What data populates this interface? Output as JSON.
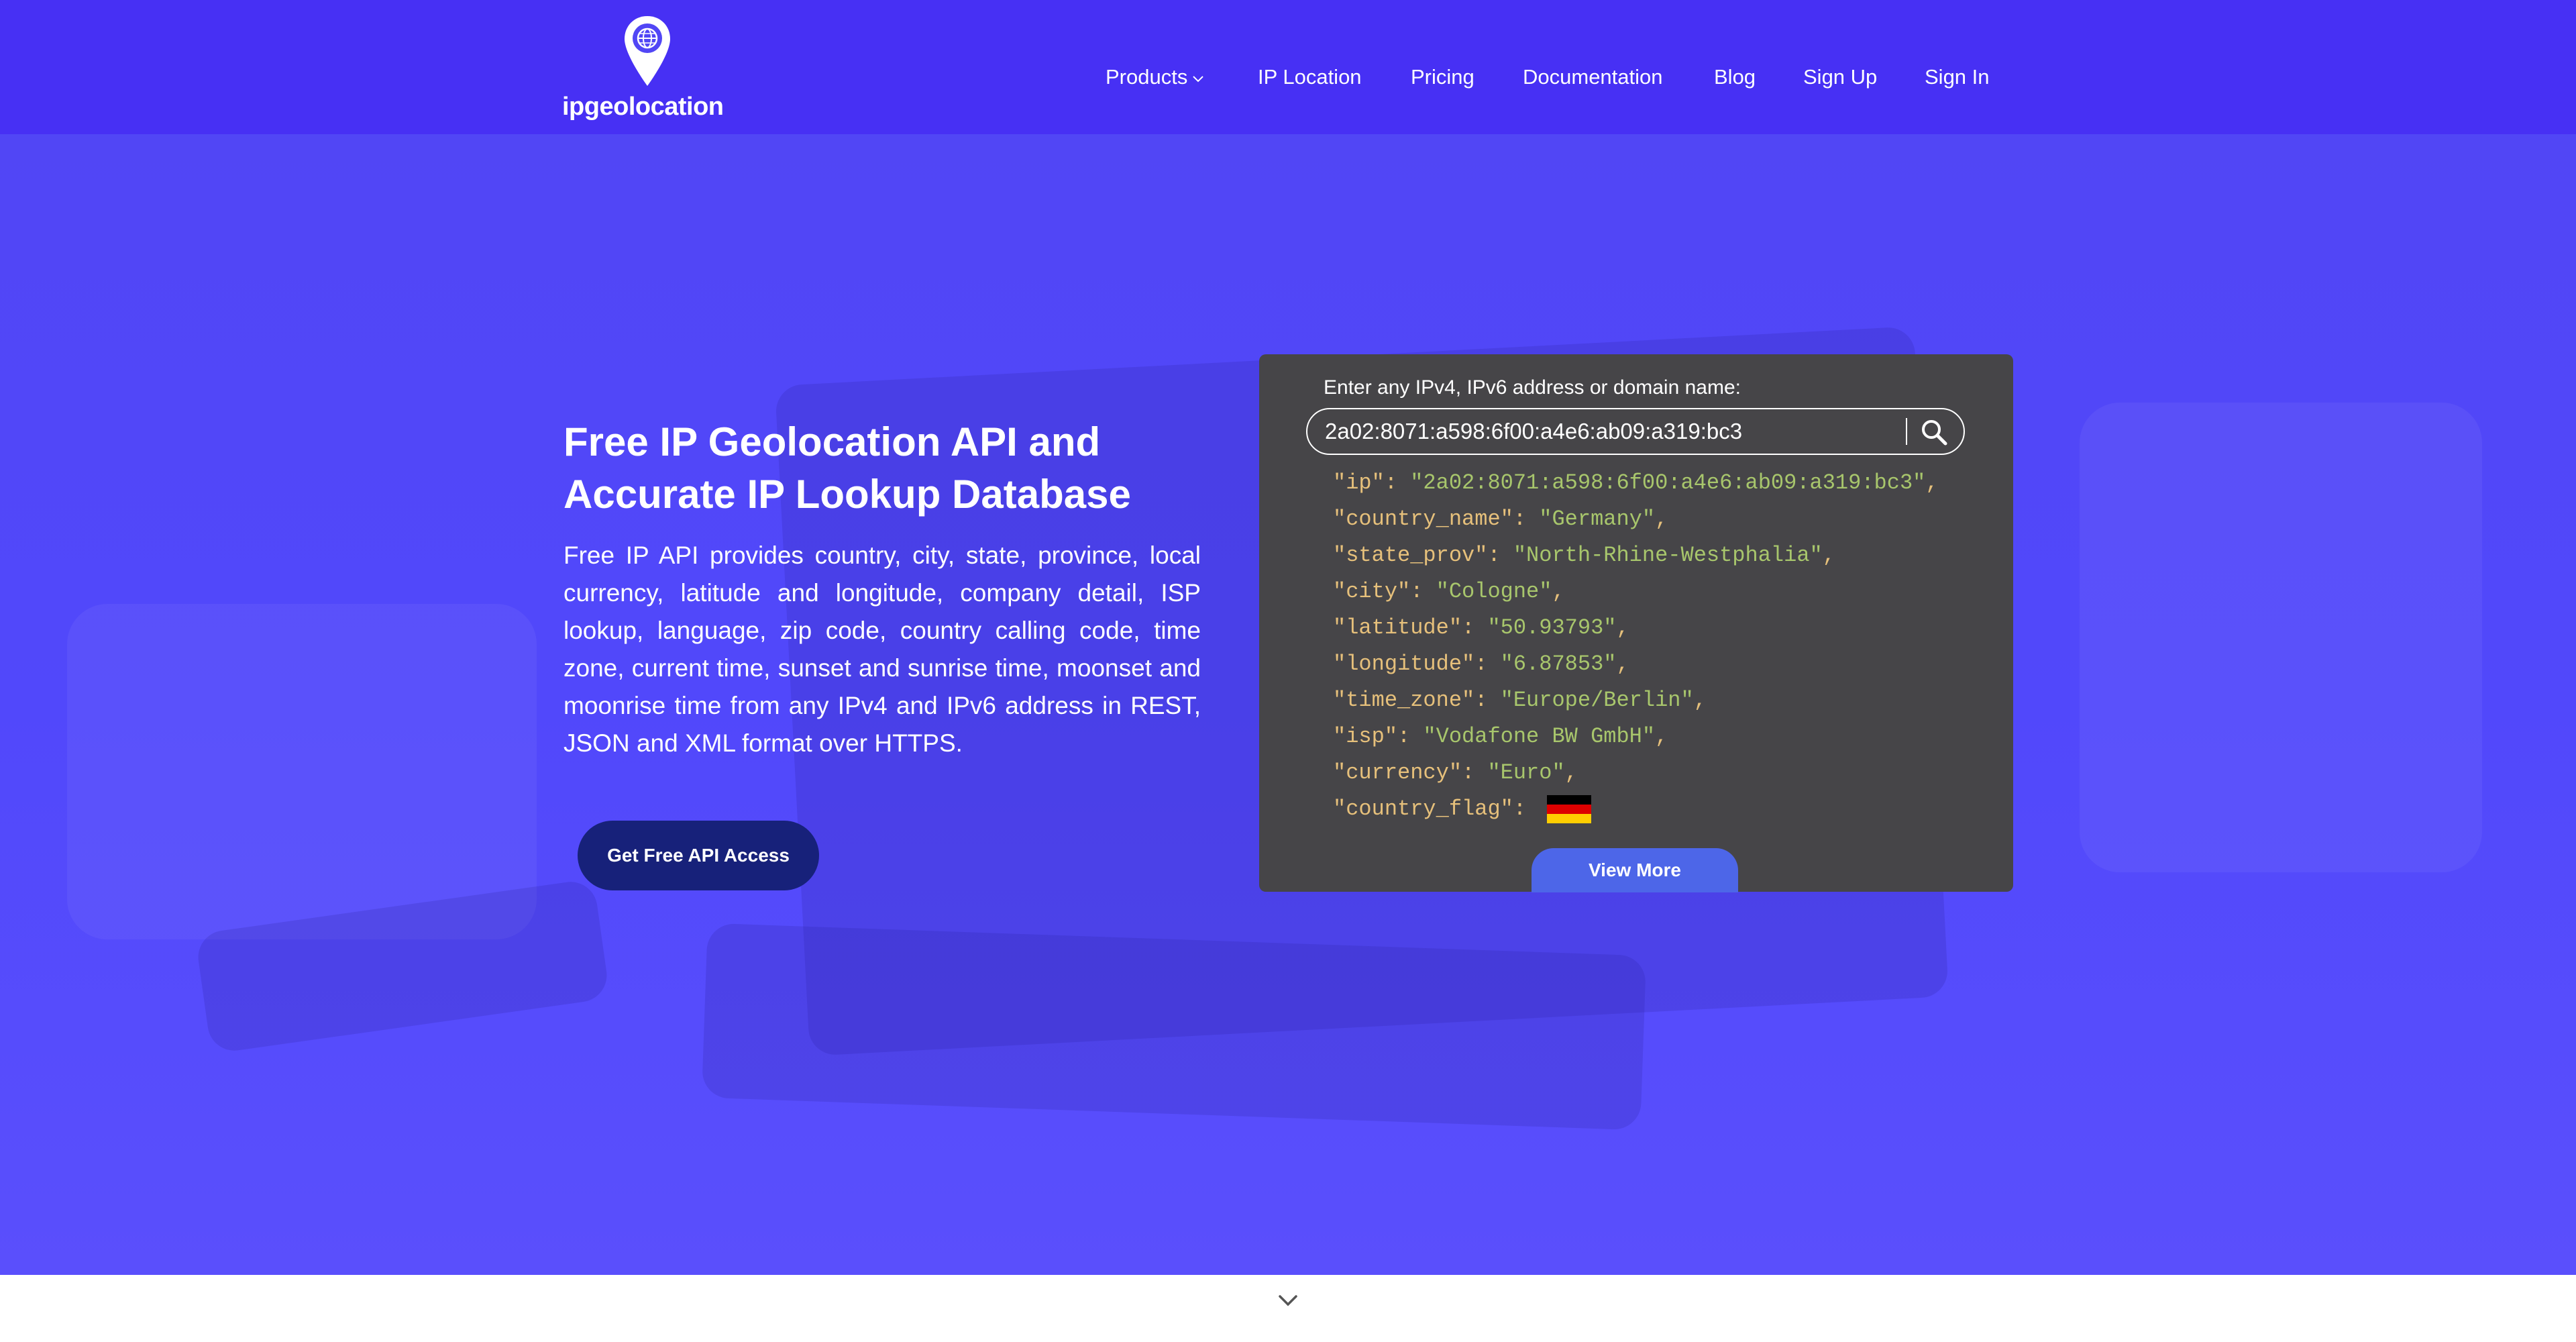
{
  "brand": {
    "name": "ipgeolocation"
  },
  "nav": {
    "items": [
      {
        "label": "Products",
        "has_dropdown": true
      },
      {
        "label": "IP Location"
      },
      {
        "label": "Pricing"
      },
      {
        "label": "Documentation"
      },
      {
        "label": "Blog"
      },
      {
        "label": "Sign Up"
      },
      {
        "label": "Sign In"
      }
    ],
    "dropdown_icon": "chevron-down-icon"
  },
  "hero": {
    "title": "Free IP Geolocation API and Accurate IP Lookup Database",
    "description": "Free IP API provides country, city, state, province, local currency, latitude and longitude, company detail, ISP lookup, language, zip code, country calling code, time zone, current time, sunset and sunrise time, moonset and moonrise time from any IPv4 and IPv6 address in REST, JSON and XML format over HTTPS.",
    "cta_label": "Get Free API Access"
  },
  "lookup": {
    "label": "Enter any IPv4, IPv6 address or domain name:",
    "value": "2a02:8071:a598:6f00:a4e6:ab09:a319:bc3",
    "search_icon": "search-icon",
    "result": {
      "ip": "2a02:8071:a598:6f00:a4e6:ab09:a319:bc3",
      "country_name": "Germany",
      "state_prov": "North-Rhine-Westphalia",
      "city": "Cologne",
      "latitude": "50.93793",
      "longitude": "6.87853",
      "time_zone": "Europe/Berlin",
      "isp": "Vodafone BW GmbH",
      "currency": "Euro"
    },
    "flag_colors": [
      "#000000",
      "#dd0000",
      "#ffce00"
    ],
    "view_more_label": "View More"
  },
  "scroll_icon": "chevron-down-icon",
  "colors": {
    "header_bg": "#4730f4",
    "hero_bg": "#5148fb",
    "panel_bg": "#464548",
    "cta_bg": "#17217a",
    "view_more_bg": "#4d66e8",
    "json_key": "#e6c07b",
    "json_value": "#a8c66c"
  }
}
